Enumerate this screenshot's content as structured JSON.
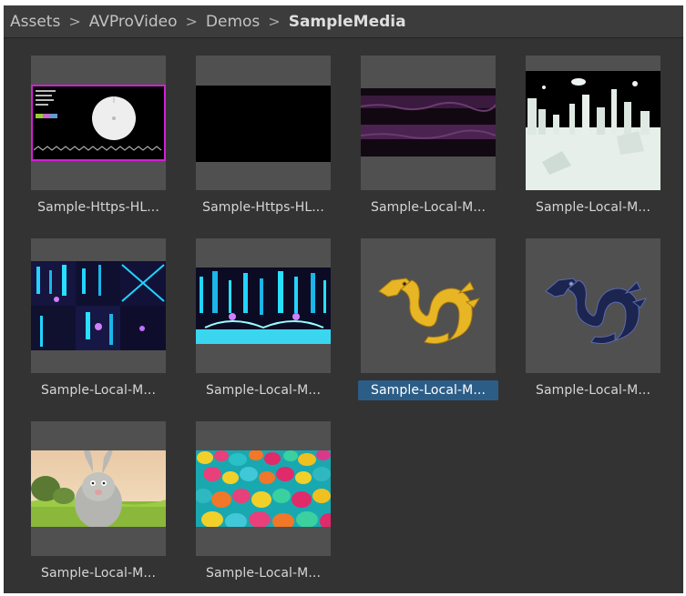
{
  "breadcrumb": [
    {
      "label": "Assets"
    },
    {
      "label": "AVProVideo"
    },
    {
      "label": "Demos"
    },
    {
      "label": "SampleMedia",
      "current": true
    }
  ],
  "separator": ">",
  "assets": [
    {
      "label": "Sample-Https-HL...",
      "thumbnail": "video-test-pattern"
    },
    {
      "label": "Sample-Https-HL...",
      "thumbnail": "black-frame"
    },
    {
      "label": "Sample-Local-M...",
      "thumbnail": "purple-stripes"
    },
    {
      "label": "Sample-Local-M...",
      "thumbnail": "white-city-360"
    },
    {
      "label": "Sample-Local-M...",
      "thumbnail": "neon-cubemap"
    },
    {
      "label": "Sample-Local-M...",
      "thumbnail": "neon-equirect"
    },
    {
      "label": "Sample-Local-M...",
      "thumbnail": "gold-dragon",
      "selected": true
    },
    {
      "label": "Sample-Local-M...",
      "thumbnail": "blue-dragon"
    },
    {
      "label": "Sample-Local-M...",
      "thumbnail": "cartoon-rabbit"
    },
    {
      "label": "Sample-Local-M...",
      "thumbnail": "colorful-cylinders"
    }
  ],
  "colors": {
    "panel": "#333333",
    "toolbar": "#3c3c3c",
    "thumb_bg": "#505050",
    "selection": "#2c5d87"
  }
}
